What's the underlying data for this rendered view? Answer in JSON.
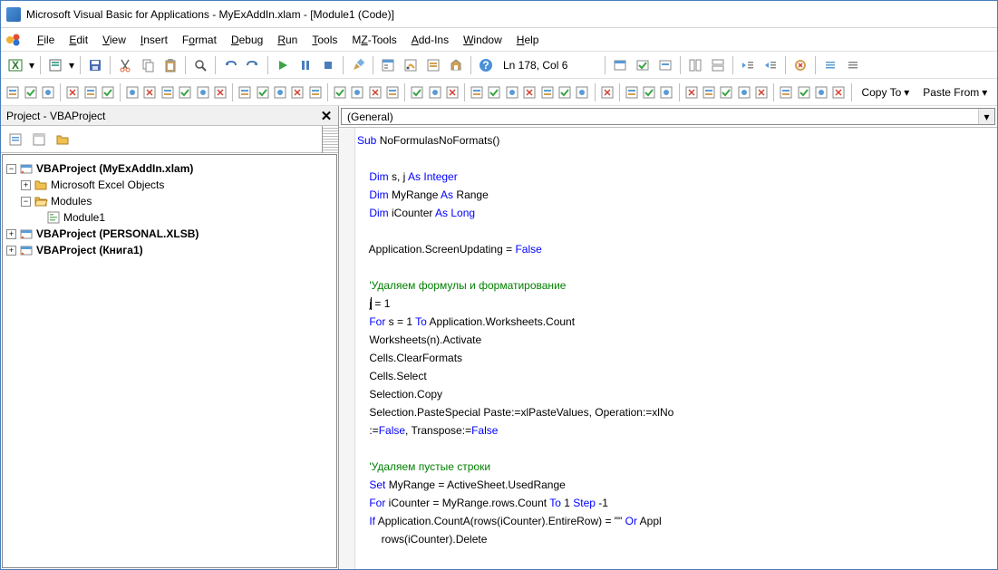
{
  "title": "Microsoft Visual Basic for Applications - MyExAddIn.xlam - [Module1 (Code)]",
  "menu": [
    "File",
    "Edit",
    "View",
    "Insert",
    "Format",
    "Debug",
    "Run",
    "Tools",
    "MZ-Tools",
    "Add-Ins",
    "Window",
    "Help"
  ],
  "status": {
    "pos": "Ln 178, Col 6",
    "copyto": "Copy To",
    "pastefrom": "Paste From"
  },
  "project": {
    "title": "Project - VBAProject",
    "root": "VBAProject (MyExAddIn.xlam)",
    "folder1": "Microsoft Excel Objects",
    "folder2": "Modules",
    "module": "Module1",
    "proj2": "VBAProject (PERSONAL.XLSB)",
    "proj3": "VBAProject (Книга1)"
  },
  "code_dd": "(General)",
  "code": [
    {
      "indent": 0,
      "t": [
        [
          "kw",
          "Sub"
        ],
        [
          "p",
          " NoFormulasNoFormats()"
        ]
      ]
    },
    {
      "indent": 0,
      "t": []
    },
    {
      "indent": 1,
      "t": [
        [
          "kw",
          "Dim"
        ],
        [
          "p",
          " s, j "
        ],
        [
          "kw",
          "As Integer"
        ]
      ]
    },
    {
      "indent": 1,
      "t": [
        [
          "kw",
          "Dim"
        ],
        [
          "p",
          " MyRange "
        ],
        [
          "kw",
          "As"
        ],
        [
          "p",
          " Range"
        ]
      ]
    },
    {
      "indent": 1,
      "t": [
        [
          "kw",
          "Dim"
        ],
        [
          "p",
          " iCounter "
        ],
        [
          "kw",
          "As Long"
        ]
      ]
    },
    {
      "indent": 0,
      "t": []
    },
    {
      "indent": 1,
      "t": [
        [
          "p",
          "Application.ScreenUpdating = "
        ],
        [
          "kw",
          "False"
        ]
      ]
    },
    {
      "indent": 0,
      "t": []
    },
    {
      "indent": 1,
      "t": [
        [
          "cm",
          "'Удаляем формулы и форматирование"
        ]
      ]
    },
    {
      "indent": 1,
      "t": [
        [
          "p",
          "j"
        ],
        [
          "caret",
          ""
        ],
        [
          "p",
          " = 1"
        ]
      ]
    },
    {
      "indent": 1,
      "t": [
        [
          "kw",
          "For"
        ],
        [
          "p",
          " s = 1 "
        ],
        [
          "kw",
          "To"
        ],
        [
          "p",
          " Application.Worksheets.Count"
        ]
      ]
    },
    {
      "indent": 1,
      "t": [
        [
          "p",
          "Worksheets(n).Activate"
        ]
      ]
    },
    {
      "indent": 1,
      "t": [
        [
          "p",
          "Cells.ClearFormats"
        ]
      ]
    },
    {
      "indent": 1,
      "t": [
        [
          "p",
          "Cells.Select"
        ]
      ]
    },
    {
      "indent": 1,
      "t": [
        [
          "p",
          "Selection.Copy"
        ]
      ]
    },
    {
      "indent": 1,
      "t": [
        [
          "p",
          "Selection.PasteSpecial Paste:=xlPasteValues, Operation:=xlNo"
        ]
      ]
    },
    {
      "indent": 1,
      "t": [
        [
          "p",
          ":="
        ],
        [
          "kw",
          "False"
        ],
        [
          "p",
          ", Transpose:="
        ],
        [
          "kw",
          "False"
        ]
      ]
    },
    {
      "indent": 0,
      "t": []
    },
    {
      "indent": 1,
      "t": [
        [
          "cm",
          "'Удаляем пустые строки"
        ]
      ]
    },
    {
      "indent": 1,
      "t": [
        [
          "kw",
          "Set"
        ],
        [
          "p",
          " MyRange = ActiveSheet.UsedRange"
        ]
      ]
    },
    {
      "indent": 1,
      "t": [
        [
          "kw",
          "For"
        ],
        [
          "p",
          " iCounter = MyRange.rows.Count "
        ],
        [
          "kw",
          "To"
        ],
        [
          "p",
          " 1 "
        ],
        [
          "kw",
          "Step"
        ],
        [
          "p",
          " -1"
        ]
      ]
    },
    {
      "indent": 1,
      "t": [
        [
          "kw",
          "If"
        ],
        [
          "p",
          " Application.CountA(rows(iCounter).EntireRow) = \"\" "
        ],
        [
          "kw",
          "Or"
        ],
        [
          "p",
          " Appl"
        ]
      ]
    },
    {
      "indent": 2,
      "t": [
        [
          "p",
          "rows(iCounter).Delete"
        ]
      ]
    }
  ]
}
